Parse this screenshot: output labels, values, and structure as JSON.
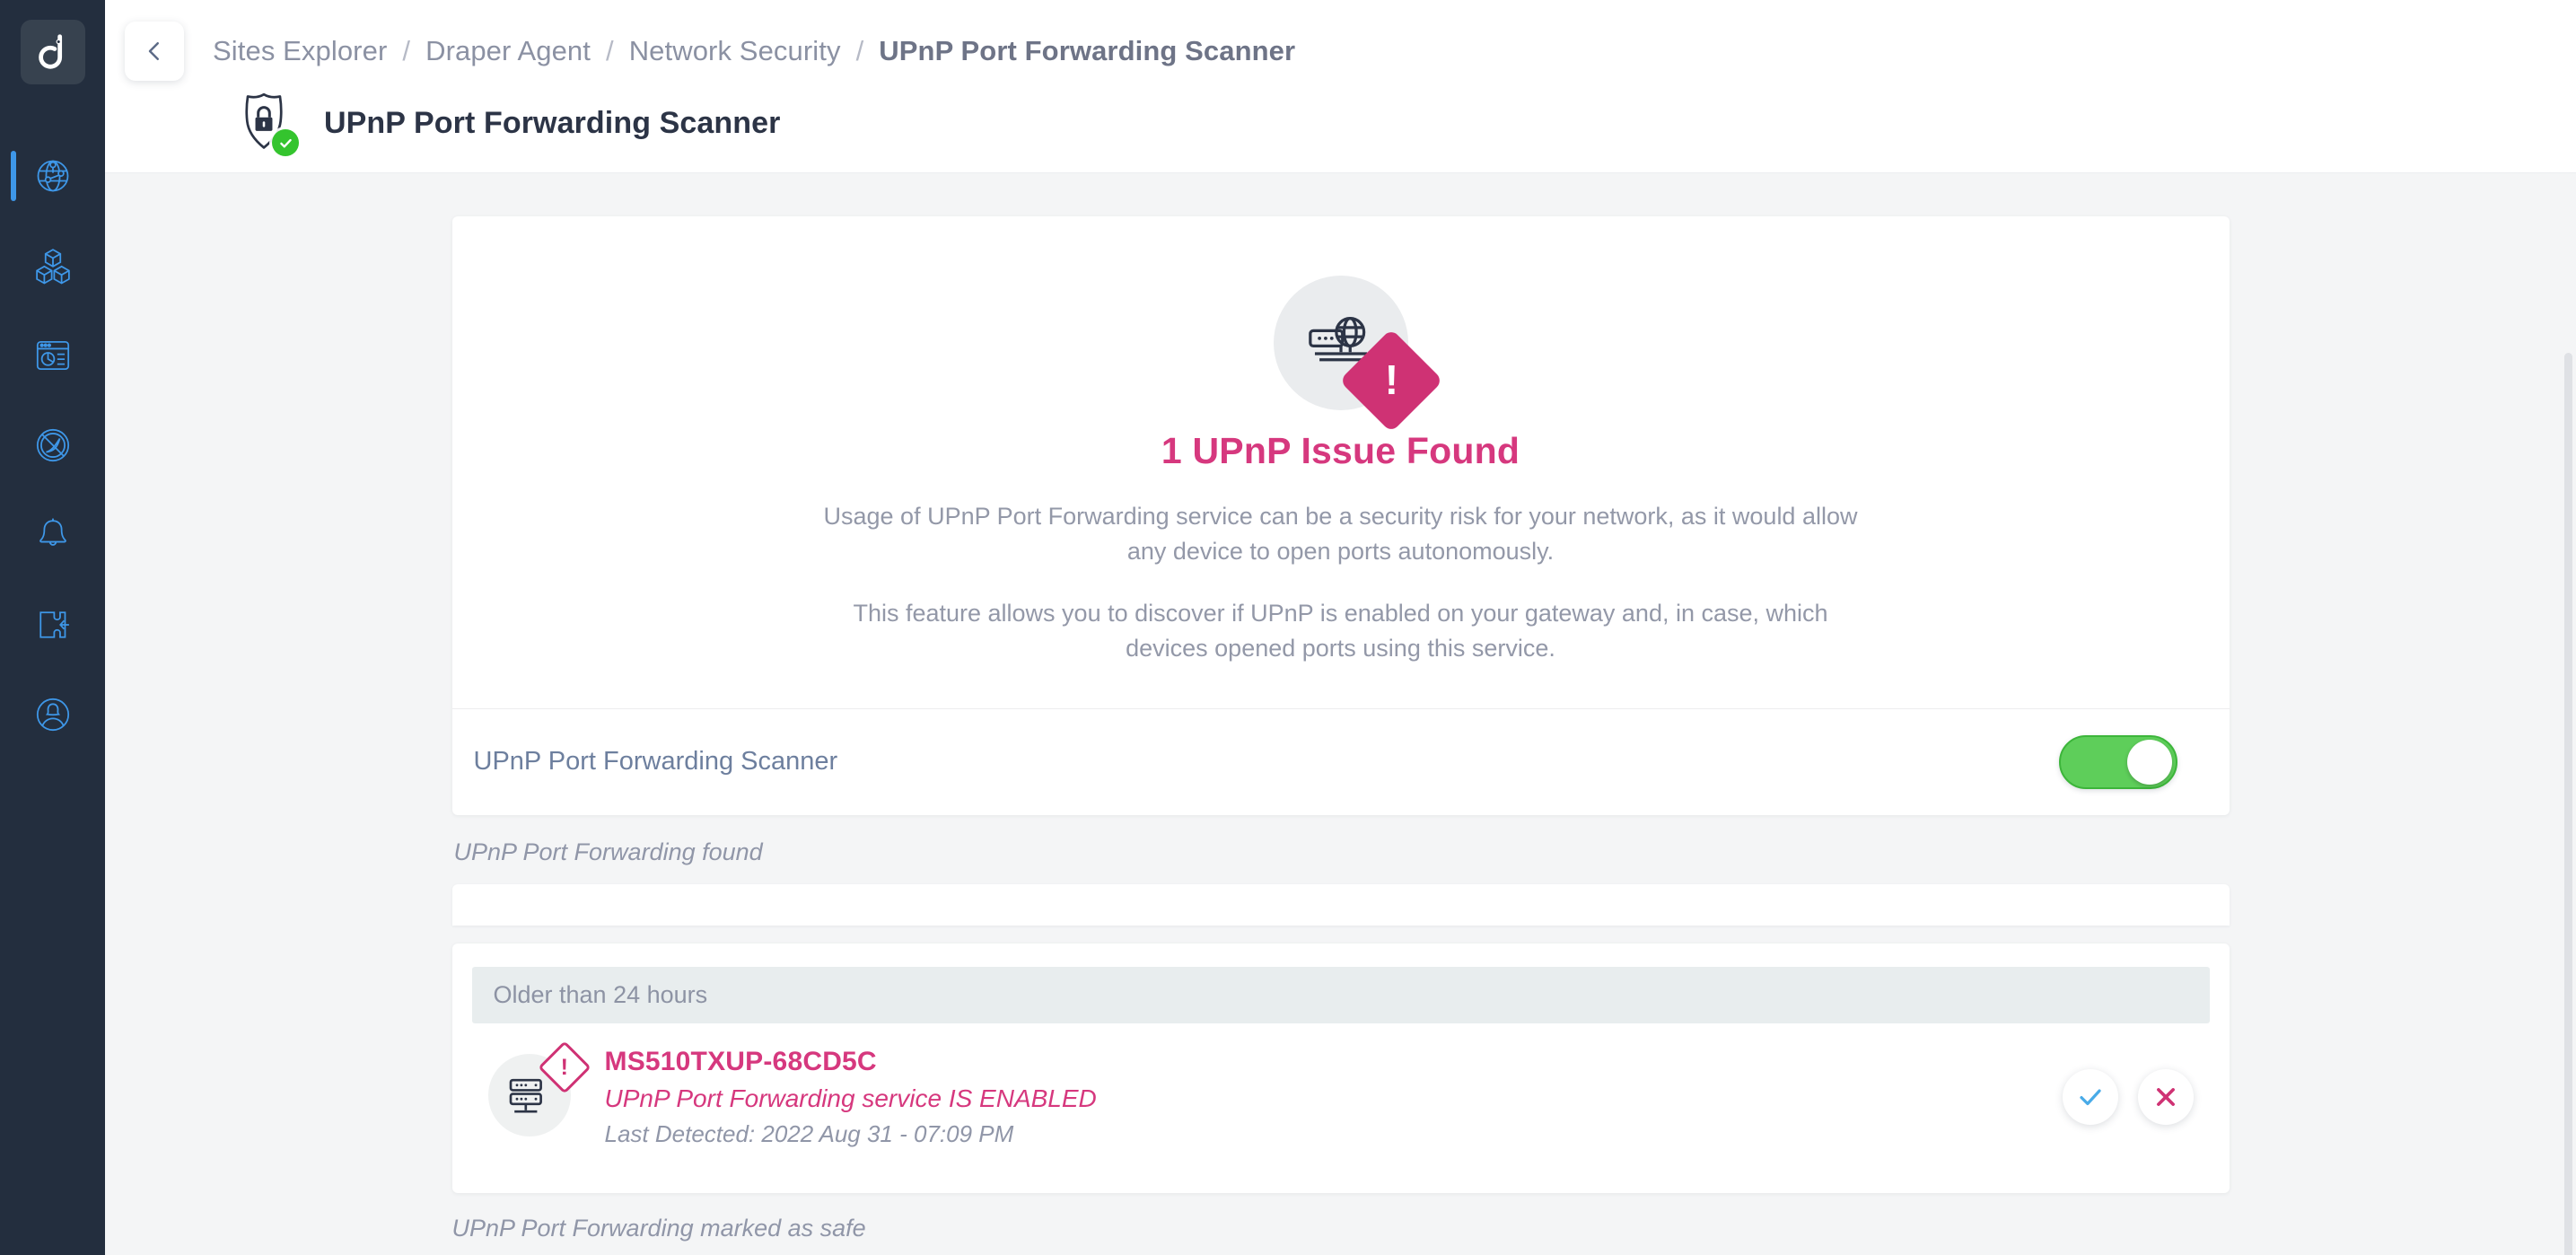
{
  "sidebar": {
    "logo_name": "domotz-logo",
    "items": [
      {
        "name": "network-globe",
        "icon": "globe-network-icon",
        "active": true
      },
      {
        "name": "inventory",
        "icon": "cubes-icon",
        "active": false
      },
      {
        "name": "reports",
        "icon": "dashboard-report-icon",
        "active": false
      },
      {
        "name": "monitoring",
        "icon": "compass-gauge-icon",
        "active": false
      },
      {
        "name": "alerts",
        "icon": "bell-icon",
        "active": false
      },
      {
        "name": "integrations",
        "icon": "puzzle-piece-icon",
        "active": false
      },
      {
        "name": "account",
        "icon": "user-circle-icon",
        "active": false
      }
    ]
  },
  "topbar": {
    "back_icon": "chevron-left-icon",
    "breadcrumbs": [
      {
        "label": "Sites Explorer"
      },
      {
        "label": "Draper Agent"
      },
      {
        "label": "Network Security"
      },
      {
        "label": "UPnP Port Forwarding Scanner"
      }
    ],
    "separator": "/",
    "title_icon": "shield-lock-icon",
    "title_badge_icon": "check-badge-icon",
    "page_title": "UPnP Port Forwarding Scanner"
  },
  "hero": {
    "icon": "router-globe-icon",
    "alert_icon": "exclamation-diamond-icon",
    "alert_mark": "!",
    "heading": "1 UPnP Issue Found",
    "paragraph_1": "Usage of UPnP Port Forwarding service can be a security risk for your network, as it would allow any device to open ports autonomously.",
    "paragraph_2": "This feature allows you to discover if UPnP is enabled on your gateway and, in case, which devices opened ports using this service."
  },
  "toggle": {
    "label": "UPnP Port Forwarding Scanner",
    "state": "on"
  },
  "found_section": {
    "label": "UPnP Port Forwarding found",
    "group_header": "Older than 24 hours",
    "rows": [
      {
        "device_icon": "server-rack-icon",
        "warning_icon": "warning-diamond-icon",
        "warning_mark": "!",
        "device_name": "MS510TXUP-68CD5C",
        "status": "UPnP Port Forwarding service IS ENABLED",
        "last_detected": "Last Detected: 2022 Aug 31 - 07:09 PM",
        "accept_icon": "check-icon",
        "dismiss_icon": "close-x-icon"
      }
    ]
  },
  "safe_section": {
    "label": "UPnP Port Forwarding marked as safe"
  },
  "colors": {
    "accent_pink": "#d6387e",
    "alert_pink": "#cf3274",
    "toggle_green": "#5ece5a",
    "badge_green": "#34c42e",
    "sidebar_bg": "#232e3e",
    "sidebar_icon": "#3e97e8",
    "check_blue": "#49abe8"
  }
}
